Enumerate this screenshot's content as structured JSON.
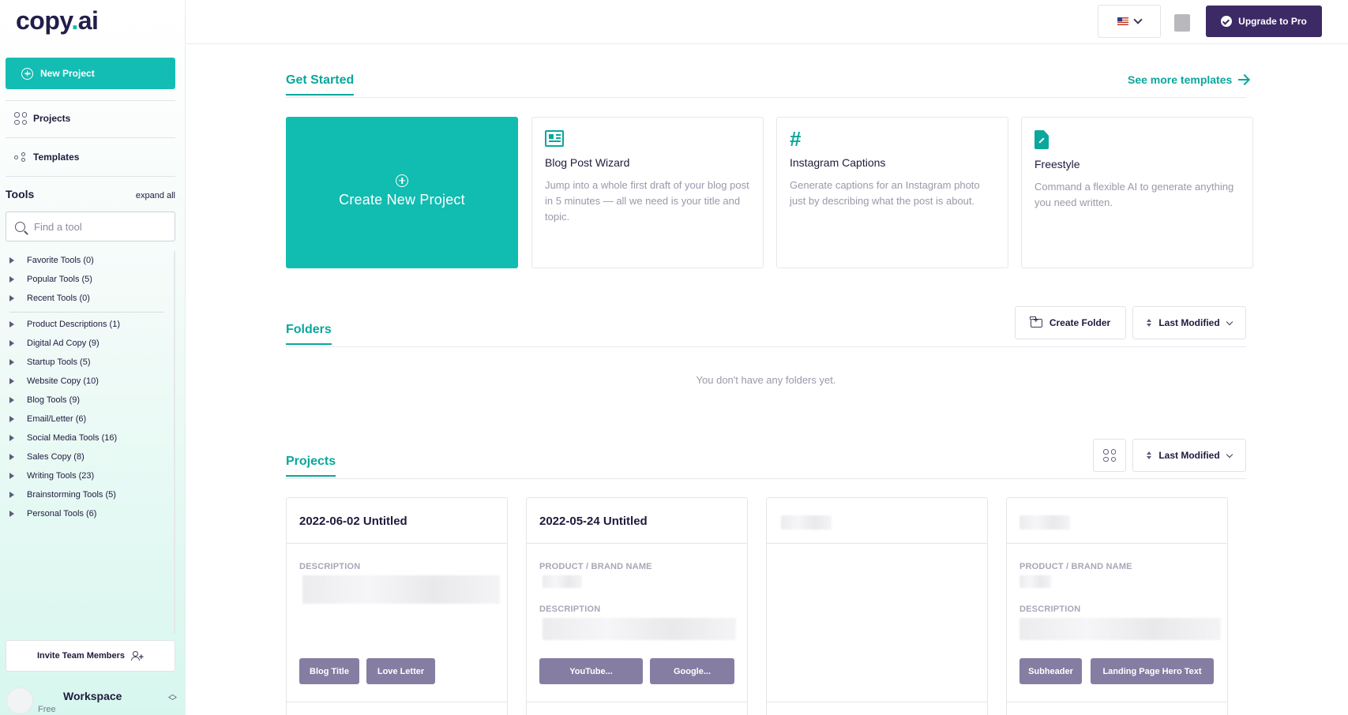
{
  "sidebar": {
    "logo_main": "copy",
    "logo_dot": ".",
    "logo_tail": "ai",
    "new_project": "New Project",
    "nav": {
      "projects": "Projects",
      "templates": "Templates"
    },
    "tools_title": "Tools",
    "expand_all": "expand all",
    "search_placeholder": "Find a tool",
    "tool_groups": [
      "Favorite Tools (0)",
      "Popular Tools (5)",
      "Recent Tools (0)",
      "Product Descriptions (1)",
      "Digital Ad Copy (9)",
      "Startup Tools (5)",
      "Website Copy (10)",
      "Blog Tools (9)",
      "Email/Letter (6)",
      "Social Media Tools (16)",
      "Sales Copy (8)",
      "Writing Tools (23)",
      "Brainstorming Tools (5)",
      "Personal Tools (6)"
    ],
    "invite": "Invite Team Members",
    "workspace": {
      "name": "Workspace",
      "plan": "Free"
    }
  },
  "topbar": {
    "upgrade": "Upgrade to Pro"
  },
  "get_started": {
    "title": "Get Started",
    "see_more": "See more templates",
    "create_label": "Create New Project",
    "templates": [
      {
        "title": "Blog Post Wizard",
        "desc": "Jump into a whole first draft of your blog post in 5 minutes — all we need is your title and topic.",
        "icon": "newspaper-icon"
      },
      {
        "title": "Instagram Captions",
        "desc": "Generate captions for an Instagram photo just by describing what the post is about.",
        "icon": "hashtag-icon"
      },
      {
        "title": "Freestyle",
        "desc": "Command a flexible AI to generate anything you need written.",
        "icon": "file-pen-icon"
      }
    ]
  },
  "folders": {
    "title": "Folders",
    "create_folder": "Create Folder",
    "sort": "Last Modified",
    "empty": "You don't have any folders yet."
  },
  "projects": {
    "title": "Projects",
    "sort": "Last Modified",
    "cards": [
      {
        "title": "2022-06-02 Untitled",
        "label1": "DESCRIPTION",
        "chips": [
          "Blog Title",
          "Love Letter"
        ]
      },
      {
        "title": "2022-05-24 Untitled",
        "label1": "PRODUCT / BRAND NAME",
        "label2": "DESCRIPTION",
        "chips": [
          "YouTube...",
          "Google..."
        ]
      },
      {
        "title": ""
      },
      {
        "title": "",
        "label1": "PRODUCT / BRAND NAME",
        "label2": "DESCRIPTION",
        "chips": [
          "Subheader",
          "Landing Page Hero Text"
        ]
      }
    ]
  }
}
